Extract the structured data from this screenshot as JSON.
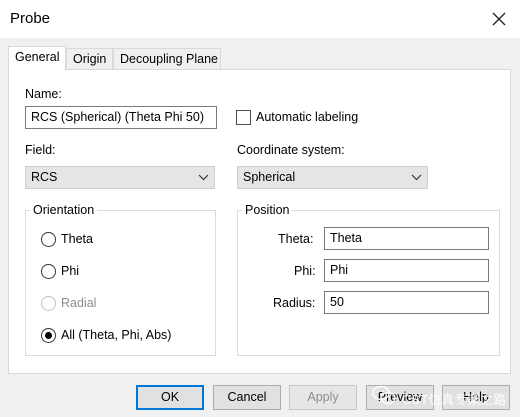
{
  "window": {
    "title": "Probe"
  },
  "tabs": [
    "General",
    "Origin",
    "Decoupling Plane"
  ],
  "general": {
    "name_label": "Name:",
    "name_value": "RCS (Spherical) (Theta Phi 50)",
    "auto_label_text": "Automatic labeling",
    "auto_label_checked": false,
    "field_label": "Field:",
    "field_value": "RCS",
    "coord_label": "Coordinate system:",
    "coord_value": "Spherical",
    "orientation": {
      "title": "Orientation",
      "options": [
        {
          "label": "Theta",
          "checked": false,
          "disabled": false
        },
        {
          "label": "Phi",
          "checked": false,
          "disabled": false
        },
        {
          "label": "Radial",
          "checked": false,
          "disabled": true
        },
        {
          "label": "All (Theta, Phi, Abs)",
          "checked": true,
          "disabled": false
        }
      ]
    },
    "position": {
      "title": "Position",
      "theta_label": "Theta:",
      "theta_value": "Theta",
      "phi_label": "Phi:",
      "phi_value": "Phi",
      "radius_label": "Radius:",
      "radius_value": "50"
    }
  },
  "buttons": {
    "ok": "OK",
    "cancel": "Cancel",
    "apply": "Apply",
    "preview": "Preview",
    "help": "Help"
  },
  "watermark": {
    "text": "CST仿真专家之路"
  },
  "colors": {
    "focus_border": "#0078d7",
    "window_bg": "#f0f0f0",
    "panel_bg": "#ffffff"
  }
}
